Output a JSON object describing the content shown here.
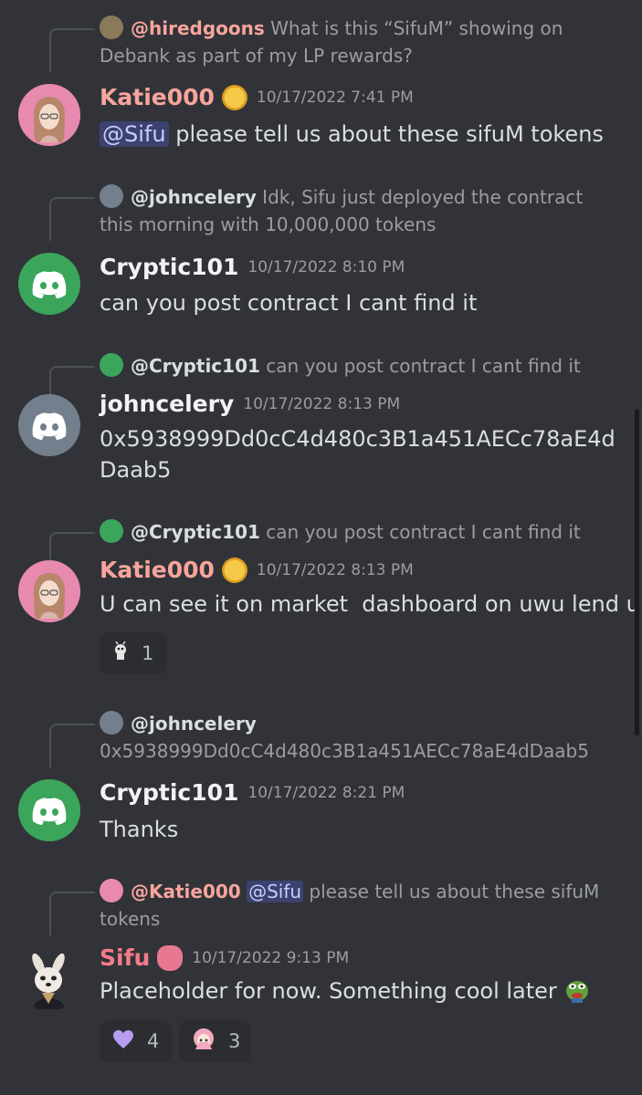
{
  "messages": [
    {
      "reply": {
        "name": "@hiredgoons",
        "text": "What is this “SifuM” showing on Debank as part of my LP rewards?"
      },
      "author": "Katie000",
      "timestamp": "10/17/2022 7:41 PM",
      "mention": "@Sifu",
      "text": "please tell us about these sifuM tokens"
    },
    {
      "reply": {
        "name": "@johncelery",
        "text": "Idk, Sifu just deployed the contract this morning with 10,000,000 tokens"
      },
      "author": "Cryptic101",
      "timestamp": "10/17/2022 8:10 PM",
      "text": "can you post contract I cant find it"
    },
    {
      "reply": {
        "name": "@Cryptic101",
        "text": "can you post contract I cant find it"
      },
      "author": "johncelery",
      "timestamp": "10/17/2022 8:13 PM",
      "text": "0x5938999Dd0cC4d480c3B1a451AECc78aE4dDaab5"
    },
    {
      "reply": {
        "name": "@Cryptic101",
        "text": "can you post contract I cant find it"
      },
      "author": "Katie000",
      "timestamp": "10/17/2022 8:13 PM",
      "text": "U can see it on market  dashboard on uwu lend ui",
      "reactions": [
        {
          "emoji": "robot-emoji",
          "count": "1"
        }
      ]
    },
    {
      "reply": {
        "name": "@johncelery",
        "text": "0x5938999Dd0cC4d480c3B1a451AECc78aE4dDaab5"
      },
      "author": "Cryptic101",
      "timestamp": "10/17/2022 8:21 PM",
      "text": "Thanks"
    },
    {
      "reply": {
        "name": "@Katie000",
        "mention": "@Sifu",
        "text": "please tell us about these sifuM tokens"
      },
      "author": "Sifu",
      "timestamp": "10/17/2022 9:13 PM",
      "text": "Placeholder for now. Something cool later",
      "reactions": [
        {
          "emoji": "purple-heart-emoji",
          "count": "4"
        },
        {
          "emoji": "anime-girl-emoji",
          "count": "3"
        }
      ]
    }
  ],
  "colors": {
    "background": "#313338",
    "username_katie": "#f7a59c",
    "username_sifu": "#f47b8a",
    "discord_green": "#3ba55c",
    "discord_grey": "#747f8d"
  }
}
